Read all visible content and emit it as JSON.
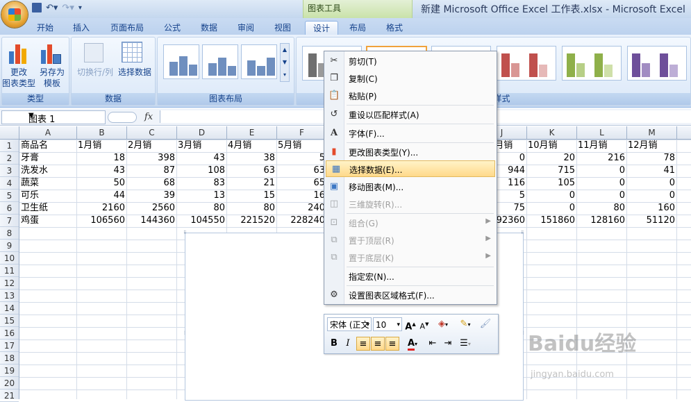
{
  "window": {
    "title": "新建 Microsoft Office Excel 工作表.xlsx - Microsoft Excel"
  },
  "contextual_tab_group": "图表工具",
  "tabs": [
    "开始",
    "插入",
    "页面布局",
    "公式",
    "数据",
    "审阅",
    "视图",
    "设计",
    "布局",
    "格式"
  ],
  "active_tab": "设计",
  "ribbon": {
    "type_group": {
      "label": "类型",
      "change_type": "更改\n图表类型",
      "save_template": "另存为\n模板"
    },
    "data_group": {
      "label": "数据",
      "switch_row_col": "切换行/列",
      "select_data": "选择数据"
    },
    "layout_group": {
      "label": "图表布局"
    },
    "style_group": {
      "label": "图表样式"
    }
  },
  "name_box": "图表 1",
  "fx_label": "fx",
  "columns": [
    "A",
    "B",
    "C",
    "D",
    "E",
    "F",
    "G",
    "H",
    "I",
    "J",
    "K",
    "L",
    "M"
  ],
  "rows": [
    "1",
    "2",
    "3",
    "4",
    "5",
    "6",
    "7",
    "8",
    "9",
    "10",
    "11",
    "12",
    "13",
    "14",
    "15",
    "16",
    "17",
    "18",
    "19",
    "20",
    "21"
  ],
  "table": {
    "header": [
      "商品名",
      "1月销",
      "2月销",
      "3月销",
      "4月销",
      "5月销"
    ],
    "header_right": [
      "0月销",
      "10月销",
      "11月销",
      "12月销"
    ],
    "body": [
      {
        "name": "牙膏",
        "left": [
          "18",
          "398",
          "43",
          "38",
          "5"
        ],
        "right": [
          "0",
          "20",
          "216",
          "78"
        ]
      },
      {
        "name": "洗发水",
        "left": [
          "43",
          "87",
          "108",
          "63",
          "63"
        ],
        "right": [
          "944",
          "715",
          "0",
          "41"
        ]
      },
      {
        "name": "蔬菜",
        "left": [
          "50",
          "68",
          "83",
          "21",
          "65"
        ],
        "right": [
          "116",
          "105",
          "0",
          "0"
        ]
      },
      {
        "name": "可乐",
        "left": [
          "44",
          "39",
          "13",
          "15",
          "16"
        ],
        "right": [
          "5",
          "0",
          "0",
          "0"
        ]
      },
      {
        "name": "卫生纸",
        "left": [
          "2160",
          "2560",
          "80",
          "80",
          "240"
        ],
        "right": [
          "75",
          "0",
          "80",
          "160"
        ]
      },
      {
        "name": "鸡蛋",
        "left": [
          "106560",
          "144360",
          "104550",
          "221520",
          "228240"
        ],
        "right": [
          "92360",
          "151860",
          "128160",
          "51120"
        ]
      }
    ]
  },
  "context_menu": [
    {
      "label": "剪切(T)",
      "icon": "scissors-icon",
      "glyph": "✂",
      "enabled": true
    },
    {
      "label": "复制(C)",
      "icon": "copy-icon",
      "glyph": "❐",
      "enabled": true
    },
    {
      "label": "粘贴(P)",
      "icon": "paste-icon",
      "glyph": "📋",
      "enabled": true
    },
    {
      "label": "重设以匹配样式(A)",
      "icon": "reset-style-icon",
      "glyph": "↺",
      "enabled": true
    },
    {
      "label": "字体(F)...",
      "icon": "font-icon",
      "glyph": "A",
      "enabled": true
    },
    {
      "label": "更改图表类型(Y)...",
      "icon": "chart-type-icon",
      "glyph": "▮",
      "enabled": true
    },
    {
      "label": "选择数据(E)...",
      "icon": "select-data-icon",
      "glyph": "▦",
      "enabled": true,
      "highlight": true
    },
    {
      "label": "移动图表(M)...",
      "icon": "move-chart-icon",
      "glyph": "▣",
      "enabled": true
    },
    {
      "label": "三维旋转(R)...",
      "icon": "rotate-3d-icon",
      "glyph": "◫",
      "enabled": false
    },
    {
      "label": "组合(G)",
      "icon": "group-icon",
      "glyph": "⊡",
      "enabled": false,
      "submenu": true
    },
    {
      "label": "置于顶层(R)",
      "icon": "bring-front-icon",
      "glyph": "⧉",
      "enabled": false,
      "submenu": true
    },
    {
      "label": "置于底层(K)",
      "icon": "send-back-icon",
      "glyph": "⧉",
      "enabled": false,
      "submenu": true
    },
    {
      "label": "指定宏(N)...",
      "icon": "macro-icon",
      "glyph": "",
      "enabled": true
    },
    {
      "label": "设置图表区域格式(F)...",
      "icon": "format-area-icon",
      "glyph": "⚙",
      "enabled": true
    }
  ],
  "mini_toolbar": {
    "font": "宋体 (正文",
    "size": "10",
    "bold": "B",
    "italic": "I",
    "grow": "A",
    "shrink": "A",
    "font_color": "A"
  },
  "watermark": {
    "brand": "Baidu经验",
    "url": "jingyan.baidu.com"
  }
}
